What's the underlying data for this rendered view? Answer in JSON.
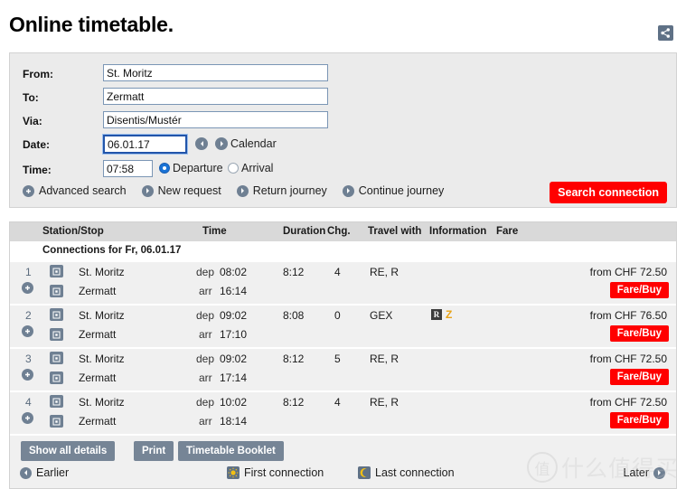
{
  "header": {
    "title": "Online timetable.",
    "share_icon": "share-icon"
  },
  "search_form": {
    "fields": [
      {
        "label": "From:",
        "value": "St. Moritz",
        "name": "from"
      },
      {
        "label": "To:",
        "value": "Zermatt",
        "name": "to"
      },
      {
        "label": "Via:",
        "value": "Disentis/Mustér",
        "name": "via"
      }
    ],
    "date": {
      "label": "Date:",
      "value": "06.01.17",
      "prev_icon": "chevron-left-icon",
      "next_icon": "chevron-right-icon",
      "calendar_label": "Calendar"
    },
    "time": {
      "label": "Time:",
      "value": "07:58",
      "departure_label": "Departure",
      "arrival_label": "Arrival",
      "selected": "Departure"
    },
    "links": [
      {
        "label": "Advanced search",
        "icon": "plus-circle-icon"
      },
      {
        "label": "New request",
        "icon": "arrow-right-circle-icon"
      },
      {
        "label": "Return journey",
        "icon": "arrow-right-circle-icon"
      },
      {
        "label": "Continue journey",
        "icon": "arrow-right-circle-icon"
      }
    ],
    "search_button": "Search connection"
  },
  "results": {
    "columns": {
      "station": "Station/Stop",
      "time": "Time",
      "duration": "Duration",
      "changes": "Chg.",
      "travel_with": "Travel with",
      "information": "Information",
      "fare": "Fare"
    },
    "subheader": "Connections for Fr, 06.01.17",
    "connections": [
      {
        "index": "1",
        "from_station": "St. Moritz",
        "to_station": "Zermatt",
        "dep_label": "dep",
        "arr_label": "arr",
        "dep_time": "08:02",
        "arr_time": "16:14",
        "duration": "8:12",
        "changes": "4",
        "travel_with": "RE, R",
        "information": "",
        "info_badge": "",
        "info_extra": "",
        "price": "from CHF 72.50",
        "fare_button": "Fare/Buy"
      },
      {
        "index": "2",
        "from_station": "St. Moritz",
        "to_station": "Zermatt",
        "dep_label": "dep",
        "arr_label": "arr",
        "dep_time": "09:02",
        "arr_time": "17:10",
        "duration": "8:08",
        "changes": "0",
        "travel_with": "GEX",
        "info_badge": "R",
        "info_extra": "Z",
        "price": "from CHF 76.50",
        "fare_button": "Fare/Buy"
      },
      {
        "index": "3",
        "from_station": "St. Moritz",
        "to_station": "Zermatt",
        "dep_label": "dep",
        "arr_label": "arr",
        "dep_time": "09:02",
        "arr_time": "17:14",
        "duration": "8:12",
        "changes": "5",
        "travel_with": "RE, R",
        "info_badge": "",
        "info_extra": "",
        "price": "from CHF 72.50",
        "fare_button": "Fare/Buy"
      },
      {
        "index": "4",
        "from_station": "St. Moritz",
        "to_station": "Zermatt",
        "dep_label": "dep",
        "arr_label": "arr",
        "dep_time": "10:02",
        "arr_time": "18:14",
        "duration": "8:12",
        "changes": "4",
        "travel_with": "RE, R",
        "info_badge": "",
        "info_extra": "",
        "price": "from CHF 72.50",
        "fare_button": "Fare/Buy"
      }
    ]
  },
  "bottom_bar": {
    "show_all_details": "Show all details",
    "print": "Print",
    "timetable_booklet": "Timetable Booklet",
    "earlier": "Earlier",
    "first_connection": "First connection",
    "last_connection": "Last connection",
    "later": "Later"
  },
  "watermark": {
    "mark": "值",
    "text": "什么值得买"
  },
  "colors": {
    "accent_red": "#ff0000",
    "icon_slate": "#6f8093",
    "panel_bg": "#ebebeb",
    "row_bg": "#f0f0f0",
    "focus_blue": "#2255aa"
  }
}
